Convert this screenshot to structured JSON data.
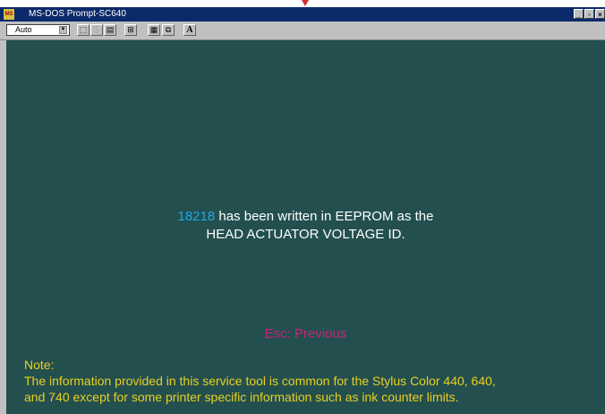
{
  "window": {
    "title": "MS-DOS Prompt-SC640",
    "app_icon": "ms-dos-icon",
    "buttons": [
      "minimize-icon",
      "maximize-icon",
      "close-icon"
    ]
  },
  "toolbar": {
    "font_size_value": "Auto",
    "font_button_label": "A",
    "icons": [
      "mark-icon",
      "copy-icon",
      "paste-icon",
      "fullscreen-icon",
      "properties-icon",
      "background-icon",
      "font-icon"
    ]
  },
  "screen": {
    "number": "18218",
    "line1_rest": " has been written in EEPROM as the",
    "line2": "HEAD ACTUATOR VOLTAGE ID.",
    "esc_text": "Esc:  Previous",
    "note_title": "Note:",
    "note_line1": "The information provided in this service tool is common for the Stylus Color 440, 640,",
    "note_line2": "and 740 except for some printer specific information such as ink counter limits."
  },
  "colors": {
    "screen_bg": "#234f4f",
    "text": "#ffffff",
    "number": "#1ea8e8",
    "esc": "#c8247a",
    "note": "#e8d020",
    "titlebar": "#0a2a6a"
  }
}
